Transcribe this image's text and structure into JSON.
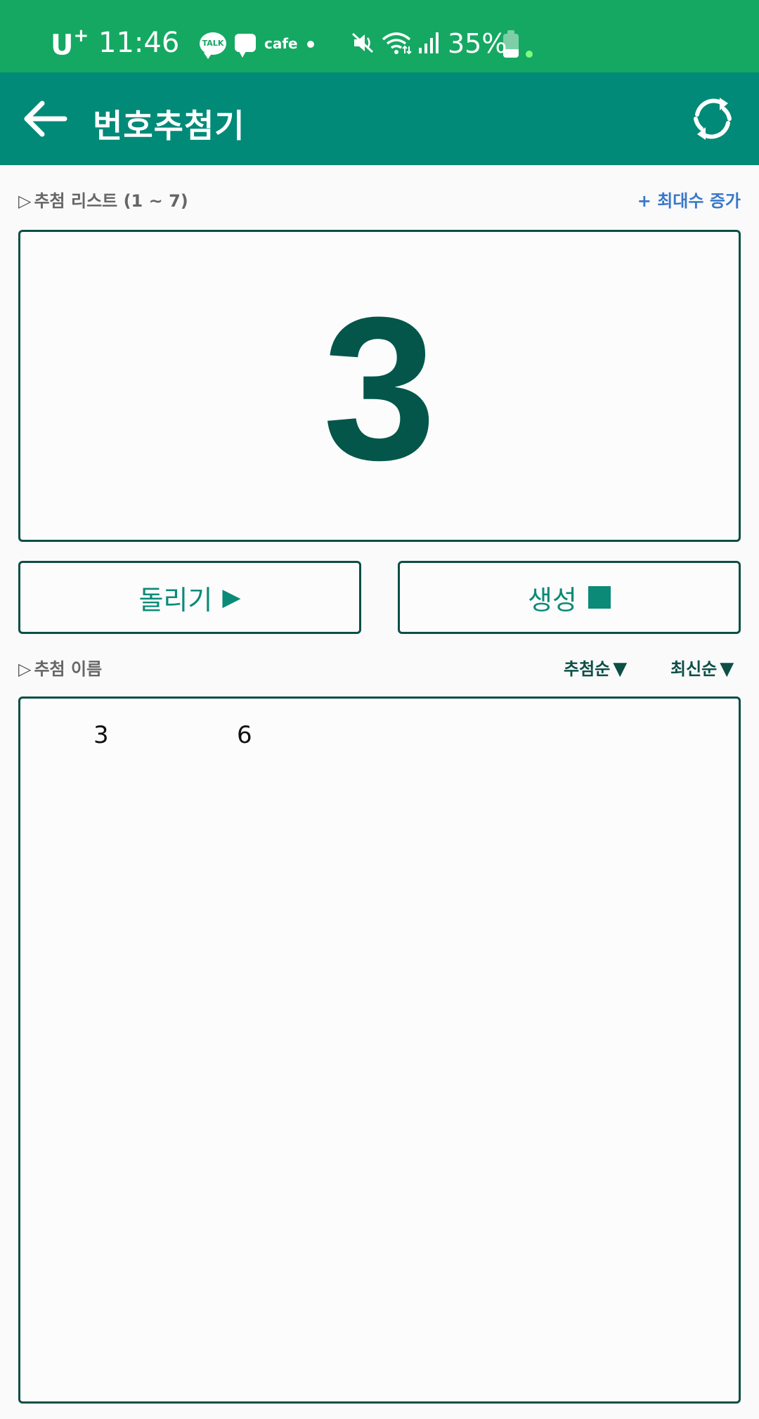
{
  "status_bar": {
    "carrier": "U",
    "carrier_sup": "+",
    "time": "11:46",
    "notification_icons": [
      "kakaotalk-icon",
      "message-icon",
      "cafe-icon",
      "dot-icon"
    ],
    "talk_label": "TALK",
    "cafe_label": "cafe",
    "battery_percent": "35%",
    "battery_level": 0.35
  },
  "app_bar": {
    "title": "번호추첨기",
    "back_icon": "arrow-left-icon",
    "refresh_icon": "refresh-icon"
  },
  "draw_list": {
    "label": "추첨 리스트 (1 ~ 7)",
    "max_increase": "+ 최대수 증가",
    "current_number": "3"
  },
  "buttons": {
    "spin_label": "돌리기",
    "spin_symbol": "▶",
    "generate_label": "생성"
  },
  "results": {
    "label": "추첨 이름",
    "sort_draw_order": "추첨순",
    "sort_latest": "최신순",
    "sort_arrow": "▼",
    "items": [
      "3",
      "6"
    ]
  },
  "colors": {
    "status_bar": "#15a862",
    "app_bar": "#028a78",
    "border": "#0b4f46",
    "accent_text": "#0b8a78",
    "big_number": "#04564a",
    "link_blue": "#3a78c8"
  }
}
